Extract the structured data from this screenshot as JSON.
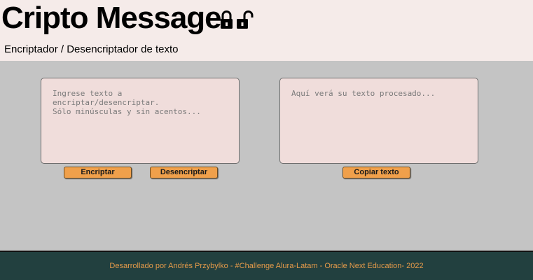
{
  "header": {
    "title": "Cripto Message",
    "subtitle": "Encriptador / Desencriptador de texto",
    "icons": [
      "lock-closed-icon",
      "lock-open-icon"
    ]
  },
  "main": {
    "input": {
      "value": "",
      "placeholder": "Ingrese texto a encriptar/desencriptar.\nSólo minúsculas y sin acentos..."
    },
    "output": {
      "value": "",
      "placeholder": "Aquí verá su texto procesado..."
    },
    "buttons": {
      "encrypt": "Encriptar",
      "decrypt": "Desencriptar",
      "copy": "Copiar texto"
    }
  },
  "footer": {
    "text": "Desarrollado por Andrés Przybylko - #Challenge Alura-Latam - Oracle Next Education- 2022"
  },
  "colors": {
    "header_bg": "#f5ebe9",
    "main_bg": "#c4c4c4",
    "textarea_bg": "#f0dddb",
    "button_bg": "#f0a04b",
    "footer_bg": "#22403f",
    "footer_text": "#e59a4a"
  }
}
